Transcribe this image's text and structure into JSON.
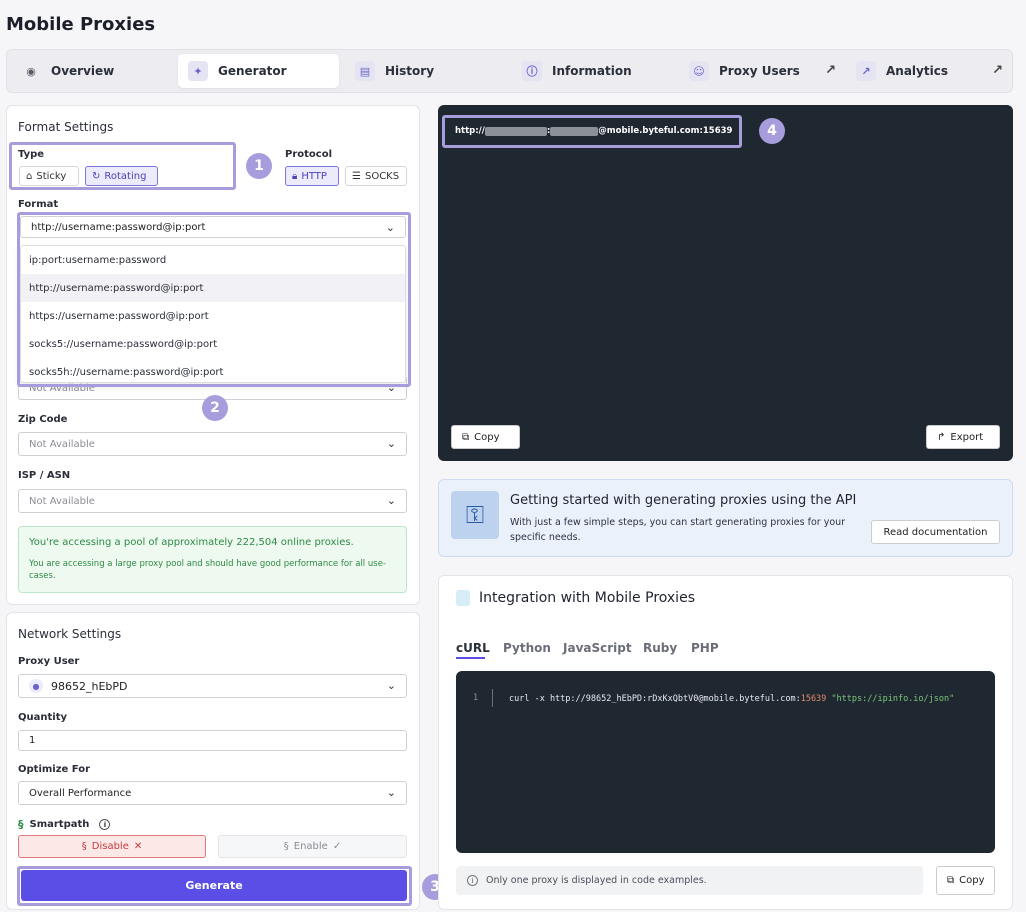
{
  "page_title": "Mobile Proxies",
  "nav": {
    "tabs": [
      {
        "label": "Overview",
        "icon": "eye-icon"
      },
      {
        "label": "Generator",
        "icon": "puzzle-icon"
      },
      {
        "label": "History",
        "icon": "document-icon"
      },
      {
        "label": "Information",
        "icon": "info-icon"
      },
      {
        "label": "Proxy Users",
        "icon": "users-icon"
      },
      {
        "label": "Analytics",
        "icon": "chart-icon"
      }
    ]
  },
  "format_settings": {
    "title": "Format Settings",
    "type_label": "Type",
    "type_options": [
      "Sticky",
      "Rotating"
    ],
    "type_selected": "Rotating",
    "protocol_label": "Protocol",
    "protocol_options": [
      "HTTP",
      "SOCKS"
    ],
    "protocol_selected": "HTTP",
    "format_label": "Format",
    "format_value": "http://username:password@ip:port",
    "format_options": [
      "ip:port:username:password",
      "http://username:password@ip:port",
      "https://username:password@ip:port",
      "socks5://username:password@ip:port",
      "socks5h://username:password@ip:port"
    ],
    "hidden_value": "Not Available",
    "zip_label": "Zip Code",
    "zip_value": "Not Available",
    "isp_label": "ISP / ASN",
    "isp_value": "Not Available",
    "pool_title": "You're accessing a pool of approximately 222,504 online proxies.",
    "pool_text": "You are accessing a large proxy pool and should have good performance for all use-cases."
  },
  "network_settings": {
    "title": "Network Settings",
    "proxy_user_label": "Proxy User",
    "proxy_user_value": "98652_hEbPD",
    "quantity_label": "Quantity",
    "quantity_value": "1",
    "optimize_label": "Optimize For",
    "optimize_value": "Overall Performance",
    "smartpath_label": "Smartpath",
    "disable_label": "Disable",
    "enable_label": "Enable",
    "generate_label": "Generate"
  },
  "output": {
    "proxy_prefix": "http://",
    "proxy_sep": ":",
    "proxy_suffix": "@mobile.byteful.com:15639",
    "copy_label": "Copy",
    "export_label": "Export"
  },
  "api_banner": {
    "title": "Getting started with generating proxies using the API",
    "text": "With just a few simple steps, you can start generating proxies for your specific needs.",
    "button": "Read documentation"
  },
  "integration": {
    "title": "Integration with Mobile Proxies",
    "tabs": [
      "cURL",
      "Python",
      "JavaScript",
      "Ruby",
      "PHP"
    ],
    "active_tab": "cURL",
    "line_no": "1",
    "code_cmd": "curl -x http://98652_hEbPD:rDxKxQbtV0@mobile.byteful.com:",
    "code_port": "15639",
    "code_url": "\"https://ipinfo.io/json\"",
    "note": "Only one proxy is displayed in code examples.",
    "copy_label": "Copy"
  },
  "markers": [
    "1",
    "2",
    "3",
    "4"
  ],
  "colors": {
    "accent": "#5b4ee6",
    "highlight": "#a79ddd",
    "dark_panel": "#1f2731",
    "success_bg": "#eef9f0",
    "success_text": "#2d8a45",
    "danger_bg": "#fde8e8"
  }
}
